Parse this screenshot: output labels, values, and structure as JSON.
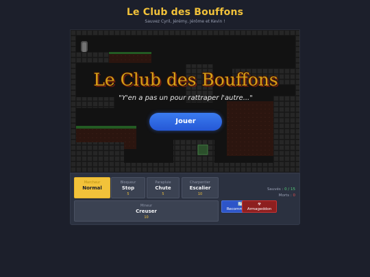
{
  "header": {
    "title": "Le Club des Bouffons",
    "subtitle": "Sauvez Cyril, Jérémy, Jérôme et Kevin !"
  },
  "game": {
    "title": "Le Club des Bouffons",
    "tagline": "\"Y'en a pas un pour rattraper l'autre...\"",
    "play_label": "Jouer"
  },
  "tools": [
    {
      "name": "Marcheur",
      "label": "Normal",
      "count": "",
      "selected": true
    },
    {
      "name": "Bloqueur",
      "label": "Stop",
      "count": "5"
    },
    {
      "name": "Parapluie",
      "label": "Chute",
      "count": "5"
    },
    {
      "name": "Charpentier",
      "label": "Escalier",
      "count": "10"
    },
    {
      "name": "Mineur",
      "label": "Creuser",
      "count": "10"
    }
  ],
  "stats": {
    "saved_label": "Sauvés :",
    "saved_value": "0 / 15",
    "dead_label": "Morts :",
    "dead_value": "0"
  },
  "actions": {
    "restart_icon": "🔄",
    "restart_label": "Recommencer",
    "armageddon_icon": "☢",
    "armageddon_label": "Armageddon"
  },
  "colors": {
    "accent": "#f2c23a",
    "play": "#2f6be6",
    "restart": "#2d55c8",
    "armageddon": "#8d1f1f"
  }
}
